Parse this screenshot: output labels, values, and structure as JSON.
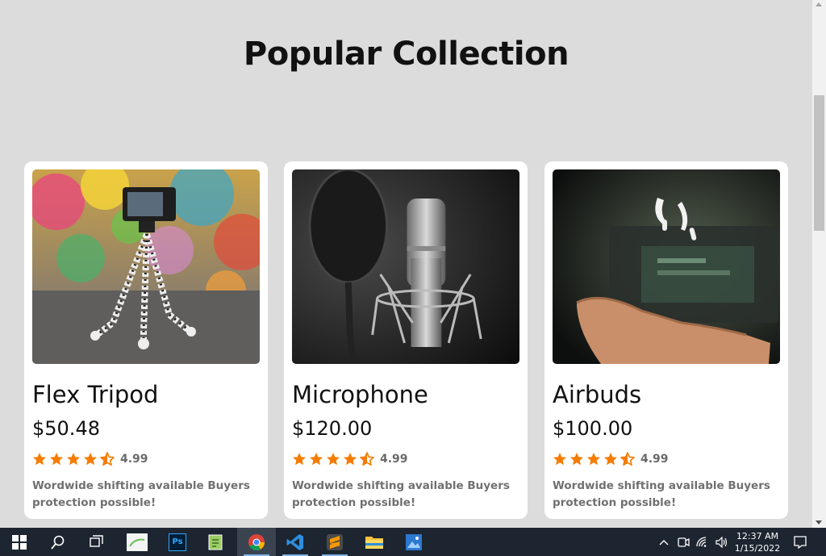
{
  "page": {
    "title": "Popular Collection"
  },
  "products": [
    {
      "name": "Flex Tripod",
      "price": "$50.48",
      "rating": "4.99",
      "stars": 4.5,
      "description": "Wordwide shifting available Buyers protection possible!",
      "image": "camera-on-tripod"
    },
    {
      "name": "Microphone",
      "price": "$120.00",
      "rating": "4.99",
      "stars": 4.5,
      "description": "Wordwide shifting available Buyers protection possible!",
      "image": "studio-microphone"
    },
    {
      "name": "Airbuds",
      "price": "$100.00",
      "rating": "4.99",
      "stars": 4.5,
      "description": "Wordwide shifting available Buyers protection possible!",
      "image": "hand-with-airbuds"
    }
  ],
  "colors": {
    "star": "#f57c00",
    "background": "#dcdcdc",
    "card": "#ffffff",
    "taskbar": "#1c2530"
  },
  "taskbar": {
    "apps": [
      "start-icon",
      "search-icon",
      "task-view-icon",
      "app-thumbnail-icon",
      "photoshop-icon",
      "notepad-icon",
      "chrome-icon",
      "vscode-icon",
      "sublime-icon",
      "file-explorer-icon",
      "photos-icon"
    ],
    "photoshop_label": "Ps",
    "time": "12:37 AM",
    "date": "1/15/2022"
  }
}
